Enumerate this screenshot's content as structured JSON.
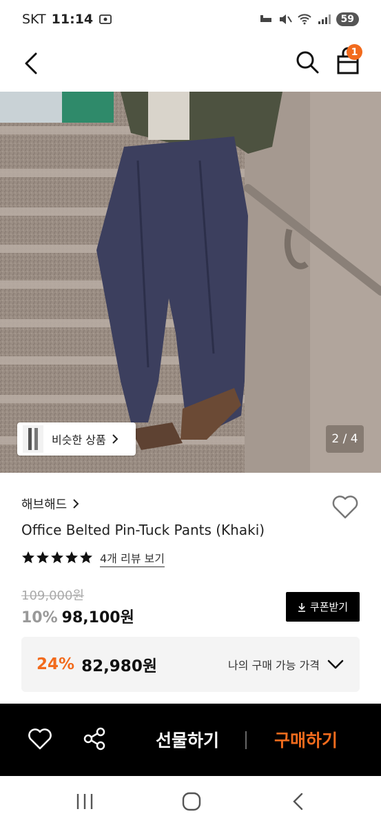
{
  "status_bar": {
    "carrier": "SKT",
    "time": "11:14",
    "battery": "59"
  },
  "header": {
    "cart_count": "1"
  },
  "gallery": {
    "similar_label": "비슷한 상품",
    "counter": "2 / 4"
  },
  "product": {
    "brand": "해브해드",
    "title": "Office Belted Pin-Tuck Pants (Khaki)",
    "rating": 5,
    "review_link": "4개 리뷰 보기",
    "original_price": "109,000원",
    "discount_rate": "10%",
    "sale_price": "98,100원",
    "coupon_label": "쿠폰받기"
  },
  "my_price": {
    "rate": "24%",
    "price": "82,980원",
    "label": "나의 구매 가능 가격"
  },
  "actions": {
    "gift_label": "선물하기",
    "buy_label": "구매하기"
  },
  "colors": {
    "accent": "#f26b1d",
    "black": "#000000"
  }
}
